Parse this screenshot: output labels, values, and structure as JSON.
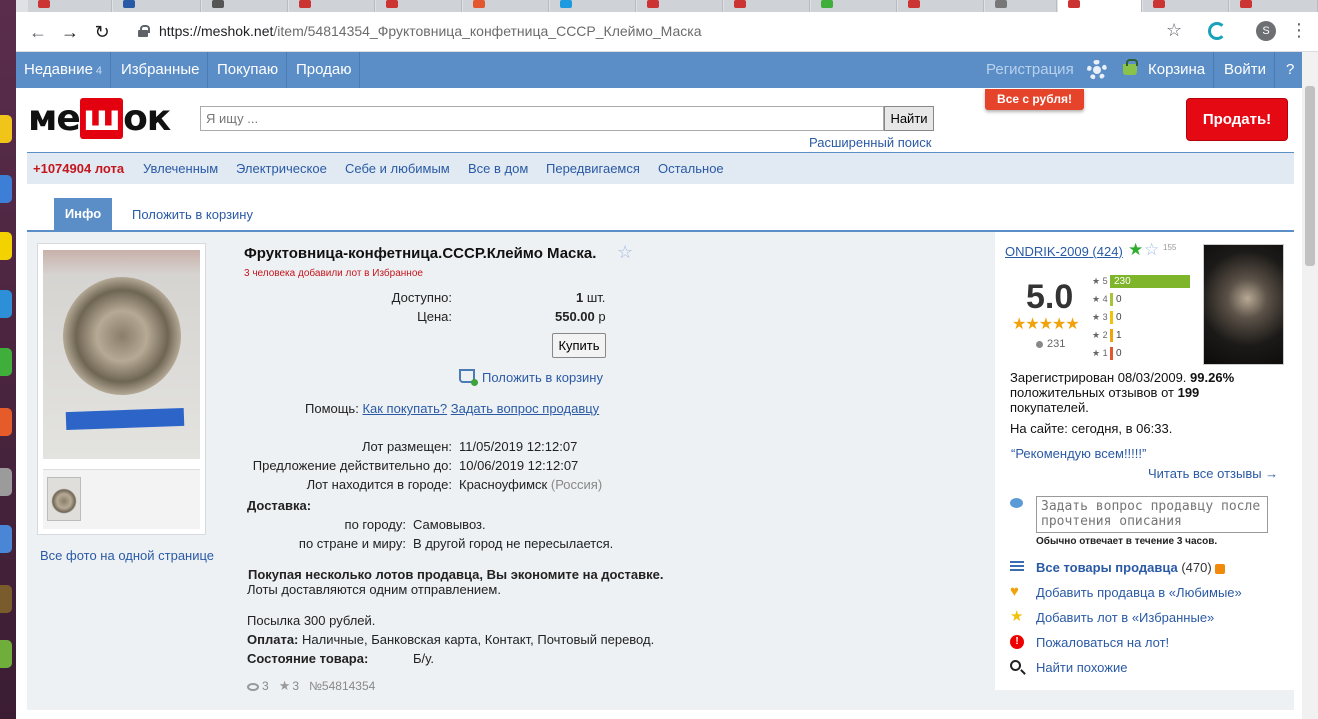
{
  "browser": {
    "url_host": "https://meshok.net",
    "url_path": "/item/54814354_Фруктовница_конфетница_СССР_Клеймо_Маска",
    "profile_initial": "S"
  },
  "topbar": {
    "recent_label": "Недавние",
    "recent_count": "4",
    "favorites_label": "Избранные",
    "buying_label": "Покупаю",
    "selling_label": "Продаю",
    "register_label": "Регистрация",
    "cart_label": "Корзина",
    "login_label": "Войти",
    "help_label": "?"
  },
  "header": {
    "logo_text_1": "ме",
    "logo_text_2": "ш",
    "logo_text_3": "ок",
    "search_placeholder": "Я ищу ...",
    "search_button": "Найти",
    "advanced_search": "Расширенный поиск",
    "promo_badge": "Все с рубля!",
    "sell_button": "Продать!"
  },
  "categories": {
    "lots": "+1074904 лота",
    "items": [
      "Увлеченным",
      "Электрическое",
      "Себе и любимым",
      "Все в дом",
      "Передвигаемся",
      "Остальное"
    ]
  },
  "tabs": {
    "info": "Инфо",
    "add_to_cart": "Положить в корзину"
  },
  "photos": {
    "all_photos_link": "Все фото на одной странице"
  },
  "lot": {
    "title": "Фруктовница-конфетница.СССР.Клеймо Маска.",
    "fav_note": "3 человека добавили лот в Избранное",
    "available_label": "Доступно:",
    "available_value": "1",
    "available_unit": "шт.",
    "price_label": "Цена:",
    "price_value": "550.00",
    "price_unit": "р",
    "buy_button": "Купить",
    "add_to_cart_link": "Положить в корзину",
    "help_label": "Помощь:",
    "how_to_buy": "Как покупать?",
    "ask_seller": "Задать вопрос продавцу",
    "placed_label": "Лот размещен:",
    "placed_value": "11/05/2019 12:12:07",
    "valid_label": "Предложение действительно до:",
    "valid_value": "10/06/2019 12:12:07",
    "city_label": "Лот находится в городе:",
    "city_value": "Красноуфимск",
    "country_value": "(Россия)",
    "delivery_label": "Доставка:",
    "by_city_label": "по городу:",
    "by_city_value": "Самовывоз.",
    "by_country_label": "по стране и миру:",
    "by_country_value": "В другой город не пересылается.",
    "multi_lot_note": "Покупая несколько лотов продавца, Вы экономите на доставке.",
    "multi_lot_sub": "Лоты доставляются одним отправлением.",
    "parcel_note": "Посылка 300 рублей.",
    "payment_label": "Оплата:",
    "payment_value": "Наличные, Банковская карта, Контакт, Почтовый перевод.",
    "condition_label": "Состояние товара:",
    "condition_value": "Б/у.",
    "views": "3",
    "stars": "3",
    "lot_number": "№54814354"
  },
  "seller": {
    "name": "ONDRIK-2009",
    "review_count": "424",
    "star_count": "155",
    "rating": "5.0",
    "rating_stars": "★★★★★",
    "reviewers": "231",
    "bars": [
      {
        "label": "★ 5",
        "value": 230,
        "color": "#7fb52a"
      },
      {
        "label": "★ 4",
        "value": 0,
        "color": "#a6c43a"
      },
      {
        "label": "★ 3",
        "value": 0,
        "color": "#f0c30a"
      },
      {
        "label": "★ 2",
        "value": 1,
        "color": "#f0a30a"
      },
      {
        "label": "★ 1",
        "value": 0,
        "color": "#e4572e"
      }
    ],
    "registered": "Зарегистрирован 08/03/2009.",
    "positive_pct": "99.26%",
    "positive_text": "положительных отзывов от",
    "buyers_count": "199",
    "buyers_text": "покупателей.",
    "online": "На сайте: сегодня, в 06:33.",
    "recommend": "“Рекомендую всем!!!!!”",
    "read_all": "Читать все отзывы →",
    "ask_placeholder": "Задать вопрос продавцу после прочтения описания",
    "reply_note": "Обычно отвечает в течение 3 часов.",
    "all_items": "Все товары продавца",
    "all_items_count": "(470)",
    "add_favorite_seller": "Добавить продавца в «Любимые»",
    "add_favorite_lot": "Добавить лот в «Избранные»",
    "complain": "Пожаловаться на лот!",
    "find_similar": "Найти похожие"
  }
}
